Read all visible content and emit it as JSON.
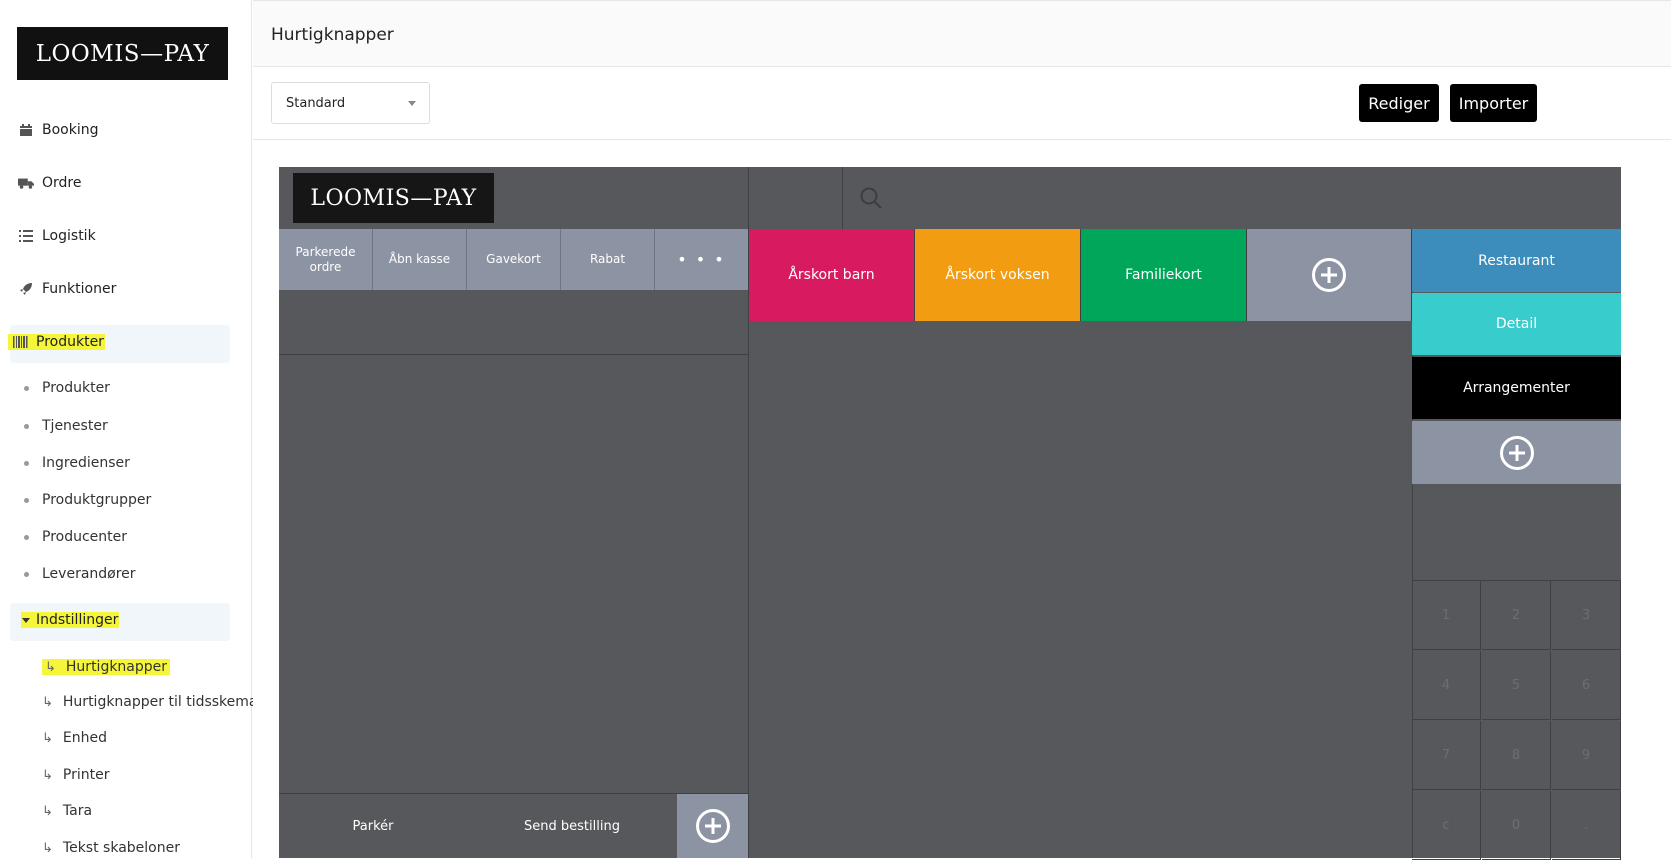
{
  "sidebar": {
    "logo": "LOOMIS—PAY",
    "items": [
      {
        "label": "Booking",
        "icon": "calendar-icon"
      },
      {
        "label": "Ordre",
        "icon": "truck-icon"
      },
      {
        "label": "Logistik",
        "icon": "list-icon"
      },
      {
        "label": "Funktioner",
        "icon": "rocket-icon"
      },
      {
        "label": "Produkter",
        "icon": "barcode-icon"
      }
    ],
    "produkter_sub": [
      "Produkter",
      "Tjenester",
      "Ingredienser",
      "Produktgrupper",
      "Producenter",
      "Leverandører"
    ],
    "indstillinger": {
      "label": "Indstillinger",
      "icon": "caret-down-icon"
    },
    "indstillinger_sub": [
      "Hurtigknapper",
      "Hurtigknapper til tidsskema",
      "Enhed",
      "Printer",
      "Tara",
      "Tekst skabeloner"
    ]
  },
  "header": {
    "title": "Hurtigknapper"
  },
  "toolbar": {
    "select_value": "Standard",
    "edit_label": "Rediger",
    "import_label": "Importer"
  },
  "pos": {
    "logo": "LOOMIS—PAY",
    "search_icon": "search-icon",
    "functions": [
      "Parkerede ordre",
      "Åbn kasse",
      "Gavekort",
      "Rabat",
      "• • •"
    ],
    "quick_buttons": [
      {
        "label": "Årskort barn",
        "color": "#d81b60"
      },
      {
        "label": "Årskort voksen",
        "color": "#f29c11"
      },
      {
        "label": "Familiekort",
        "color": "#00a65a"
      }
    ],
    "categories": [
      {
        "label": "Restaurant",
        "color": "#3c8dbc"
      },
      {
        "label": "Detail",
        "color": "#39cccc"
      },
      {
        "label": "Arrangementer",
        "color": "#000000"
      }
    ],
    "numpad": [
      "1",
      "2",
      "3",
      "4",
      "5",
      "6",
      "7",
      "8",
      "9",
      "c",
      "0",
      "."
    ],
    "bottom": {
      "park_label": "Parkér",
      "send_label": "Send bestilling"
    }
  }
}
